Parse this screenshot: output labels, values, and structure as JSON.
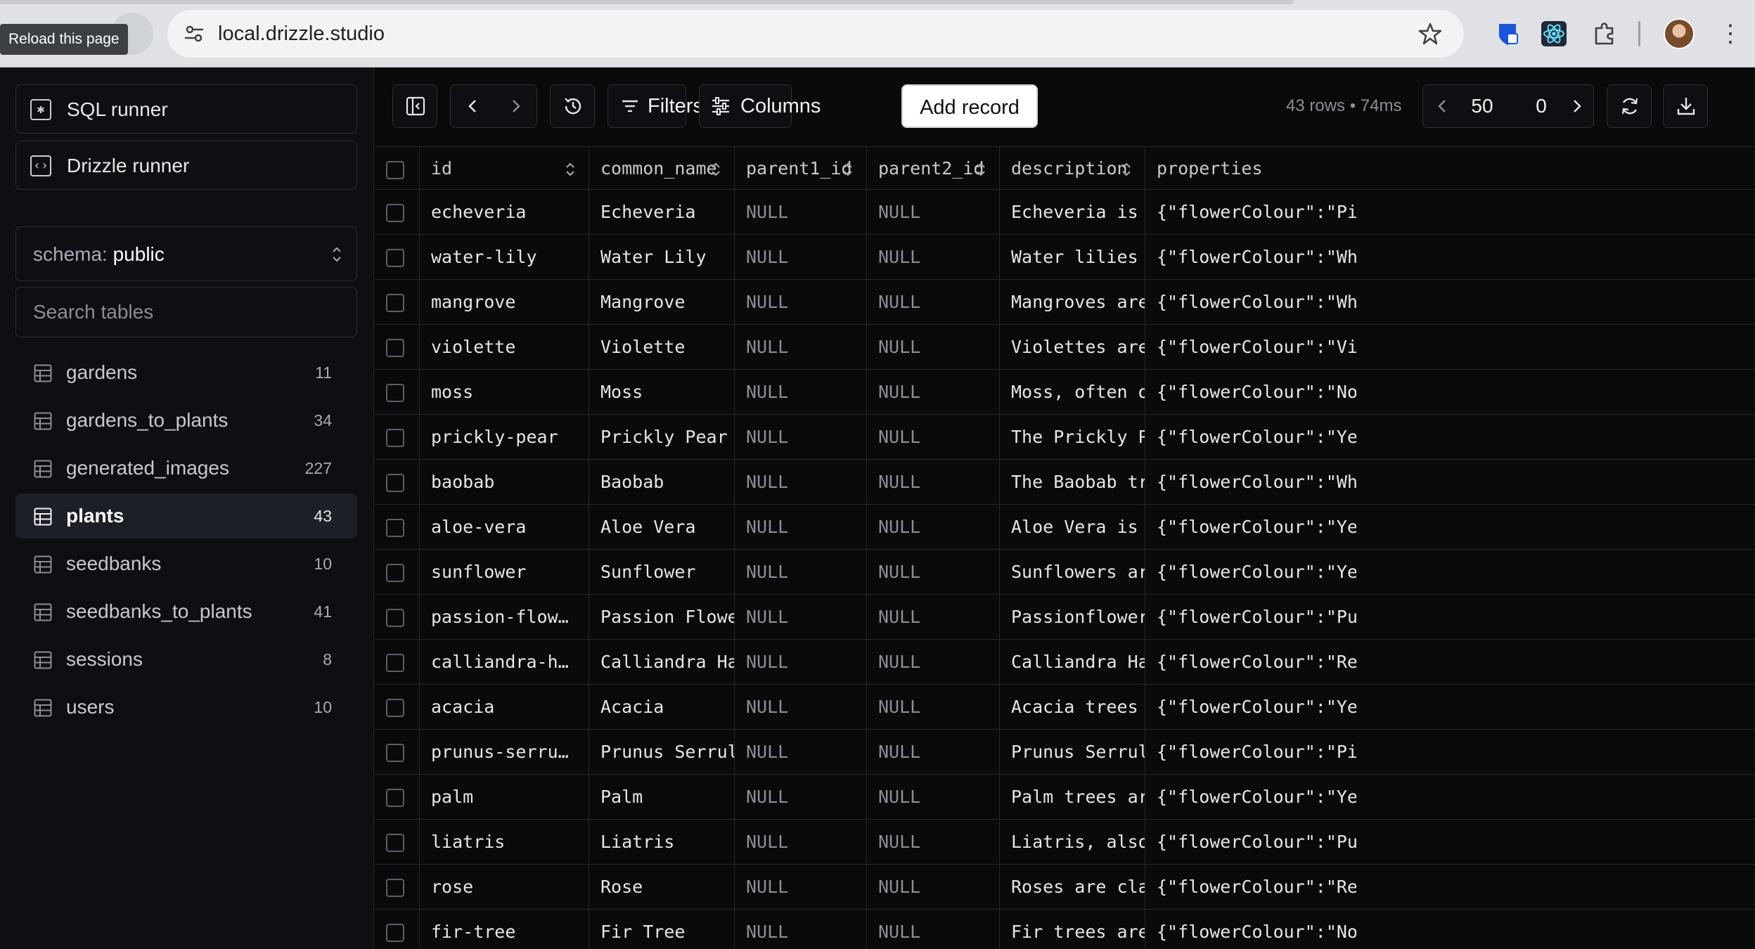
{
  "browser": {
    "tooltip": "Reload this page",
    "url": "local.drizzle.studio"
  },
  "sidebar": {
    "sql_runner": "SQL runner",
    "drizzle_runner": "Drizzle runner",
    "schema_label": "schema: ",
    "schema_value": "public",
    "search_placeholder": "Search tables",
    "tables": [
      {
        "name": "gardens",
        "count": "11"
      },
      {
        "name": "gardens_to_plants",
        "count": "34"
      },
      {
        "name": "generated_images",
        "count": "227"
      },
      {
        "name": "plants",
        "count": "43"
      },
      {
        "name": "seedbanks",
        "count": "10"
      },
      {
        "name": "seedbanks_to_plants",
        "count": "41"
      },
      {
        "name": "sessions",
        "count": "8"
      },
      {
        "name": "users",
        "count": "10"
      }
    ]
  },
  "toolbar": {
    "filters": "Filters",
    "columns": "Columns",
    "add_record": "Add record",
    "stats": "43 rows • 74ms",
    "limit": "50",
    "offset": "0"
  },
  "table": {
    "headers": [
      "id",
      "common_name",
      "parent1_id",
      "parent2_id",
      "description",
      "properties"
    ],
    "rows": [
      [
        "echeveria",
        "Echeveria",
        "NULL",
        "NULL",
        "Echeveria is a ch…",
        "{\"flowerColour\":\"Pink\",\"f"
      ],
      [
        "water-lily",
        "Water Lily",
        "NULL",
        "NULL",
        "Water lilies are …",
        "{\"flowerColour\":\"White\",\""
      ],
      [
        "mangrove",
        "Mangrove",
        "NULL",
        "NULL",
        "Mangroves are vit…",
        "{\"flowerColour\":\"White\",\""
      ],
      [
        "violette",
        "Violette",
        "NULL",
        "NULL",
        "Violettes are del…",
        "{\"flowerColour\":\"Violet\","
      ],
      [
        "moss",
        "Moss",
        "NULL",
        "NULL",
        "Moss, often overl…",
        "{\"flowerColour\":\"None\",\"f"
      ],
      [
        "prickly-pear",
        "Prickly Pear",
        "NULL",
        "NULL",
        "The Prickly Pear …",
        "{\"flowerColour\":\"Yellow\","
      ],
      [
        "baobab",
        "Baobab",
        "NULL",
        "NULL",
        "The Baobab tree i…",
        "{\"flowerColour\":\"White\",\""
      ],
      [
        "aloe-vera",
        "Aloe Vera",
        "NULL",
        "NULL",
        "Aloe Vera is a su…",
        "{\"flowerColour\":\"Yellow\","
      ],
      [
        "sunflower",
        "Sunflower",
        "NULL",
        "NULL",
        "Sunflowers are kn…",
        "{\"flowerColour\":\"Yellow\","
      ],
      [
        "passion-flow…",
        "Passion Flower",
        "NULL",
        "NULL",
        "Passionflowers ar…",
        "{\"flowerColour\":\"Purple\","
      ],
      [
        "calliandra-h…",
        "Calliandra Haemat…",
        "NULL",
        "NULL",
        "Calliandra Haemat…",
        "{\"flowerColour\":\"Red\",\"fl"
      ],
      [
        "acacia",
        "Acacia",
        "NULL",
        "NULL",
        "Acacia trees have…",
        "{\"flowerColour\":\"Yellow\","
      ],
      [
        "prunus-serru…",
        "Prunus Serrulata",
        "NULL",
        "NULL",
        "Prunus Serrulata,…",
        "{\"flowerColour\":\"Pink\",\"f"
      ],
      [
        "palm",
        "Palm",
        "NULL",
        "NULL",
        "Palm trees are tr…",
        "{\"flowerColour\":\"Yellow\","
      ],
      [
        "liatris",
        "Liatris",
        "NULL",
        "NULL",
        "Liatris, also kno…",
        "{\"flowerColour\":\"Purple\","
      ],
      [
        "rose",
        "Rose",
        "NULL",
        "NULL",
        "Roses are classic…",
        "{\"flowerColour\":\"Red\",\"fl"
      ],
      [
        "fir-tree",
        "Fir Tree",
        "NULL",
        "NULL",
        "Fir trees are tow…",
        "{\"flowerColour\":\"None\",\"f"
      ]
    ]
  }
}
